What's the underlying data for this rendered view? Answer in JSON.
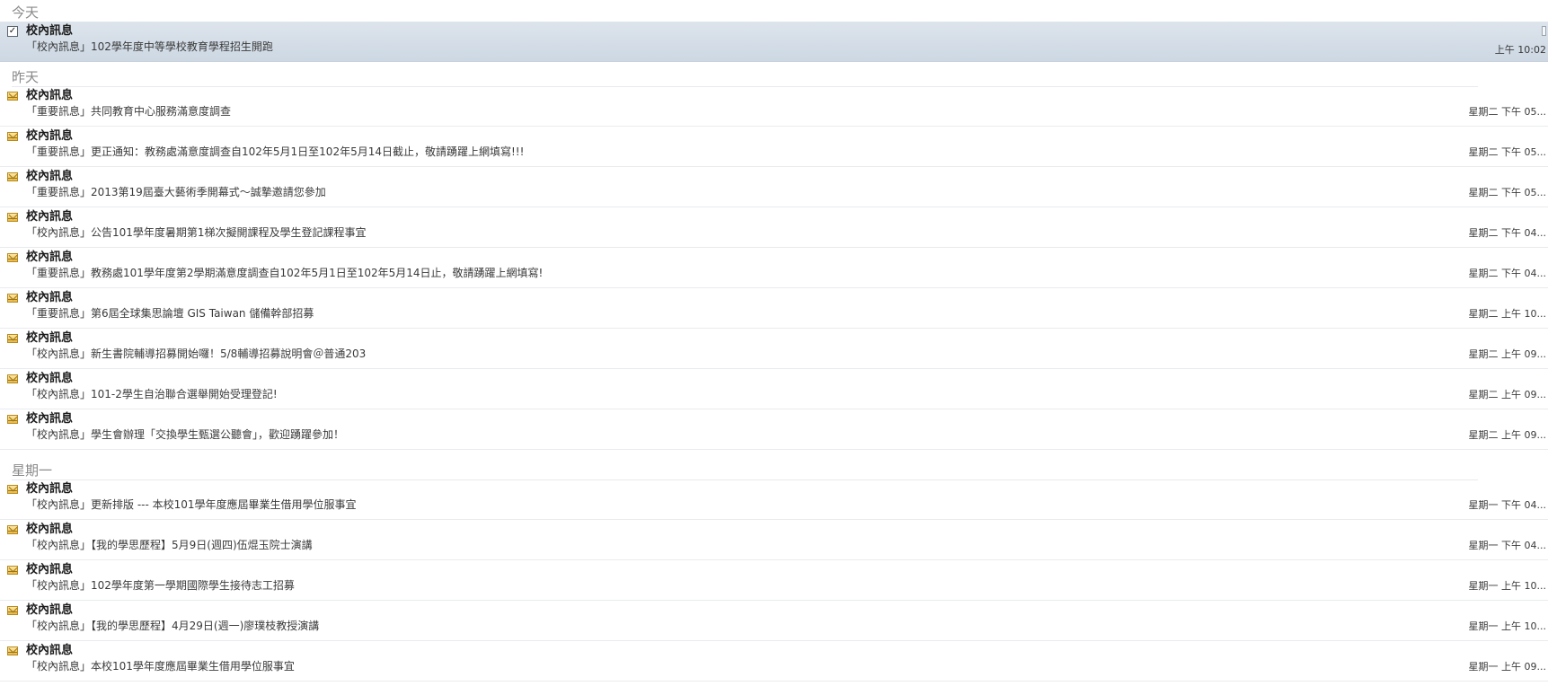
{
  "groups": [
    {
      "label": "今天",
      "messages": [
        {
          "sender": "校內訊息",
          "subject": "「校內訊息」102學年度中等學校教育學程招生開跑",
          "time": "上午 10:02",
          "selected": true
        }
      ]
    },
    {
      "label": "昨天",
      "messages": [
        {
          "sender": "校內訊息",
          "subject": "「重要訊息」共同教育中心服務滿意度調查",
          "time": "星期二 下午 05..."
        },
        {
          "sender": "校內訊息",
          "subject": "「重要訊息」更正通知：教務處滿意度調查自102年5月1日至102年5月14日截止，敬請踴躍上網填寫!!!",
          "time": "星期二 下午 05..."
        },
        {
          "sender": "校內訊息",
          "subject": "「重要訊息」2013第19屆臺大藝術季開幕式～誠摯邀請您參加",
          "time": "星期二 下午 05..."
        },
        {
          "sender": "校內訊息",
          "subject": "「校內訊息」公告101學年度暑期第1梯次擬開課程及學生登記課程事宜",
          "time": "星期二 下午 04..."
        },
        {
          "sender": "校內訊息",
          "subject": "「重要訊息」教務處101學年度第2學期滿意度調查自102年5月1日至102年5月14日止，敬請踴躍上網填寫!",
          "time": "星期二 下午 04..."
        },
        {
          "sender": "校內訊息",
          "subject": "「重要訊息」第6屆全球集思論壇 GIS Taiwan 儲備幹部招募",
          "time": "星期二 上午 10..."
        },
        {
          "sender": "校內訊息",
          "subject": "「校內訊息」新生書院輔導招募開始囉！5/8輔導招募說明會＠普通203",
          "time": "星期二 上午 09..."
        },
        {
          "sender": "校內訊息",
          "subject": "「校內訊息」101-2學生自治聯合選舉開始受理登記!",
          "time": "星期二 上午 09..."
        },
        {
          "sender": "校內訊息",
          "subject": "「校內訊息」學生會辦理「交換學生甄選公聽會」，歡迎踴躍參加！",
          "time": "星期二 上午 09..."
        }
      ]
    },
    {
      "label": "星期一",
      "messages": [
        {
          "sender": "校內訊息",
          "subject": "「校內訊息」更新排版 --- 本校101學年度應屆畢業生借用學位服事宜",
          "time": "星期一 下午 04..."
        },
        {
          "sender": "校內訊息",
          "subject": "「校內訊息」【我的學思歷程】5月9日(週四)伍焜玉院士演講",
          "time": "星期一 下午 04..."
        },
        {
          "sender": "校內訊息",
          "subject": "「校內訊息」102學年度第一學期國際學生接待志工招募",
          "time": "星期一 上午 10..."
        },
        {
          "sender": "校內訊息",
          "subject": "「校內訊息」【我的學思歷程】4月29日(週一)廖璞枝教授演講",
          "time": "星期一 上午 10..."
        },
        {
          "sender": "校內訊息",
          "subject": "「校內訊息」本校101學年度應屆畢業生借用學位服事宜",
          "time": "星期一 上午 09..."
        }
      ]
    }
  ],
  "icons": {
    "unread": "envelope-icon",
    "selected": "checkbox-icon"
  },
  "colors": {
    "selected_row": "#d3dde8",
    "group_label": "#8a8a8a",
    "separator": "#e8ebef"
  }
}
